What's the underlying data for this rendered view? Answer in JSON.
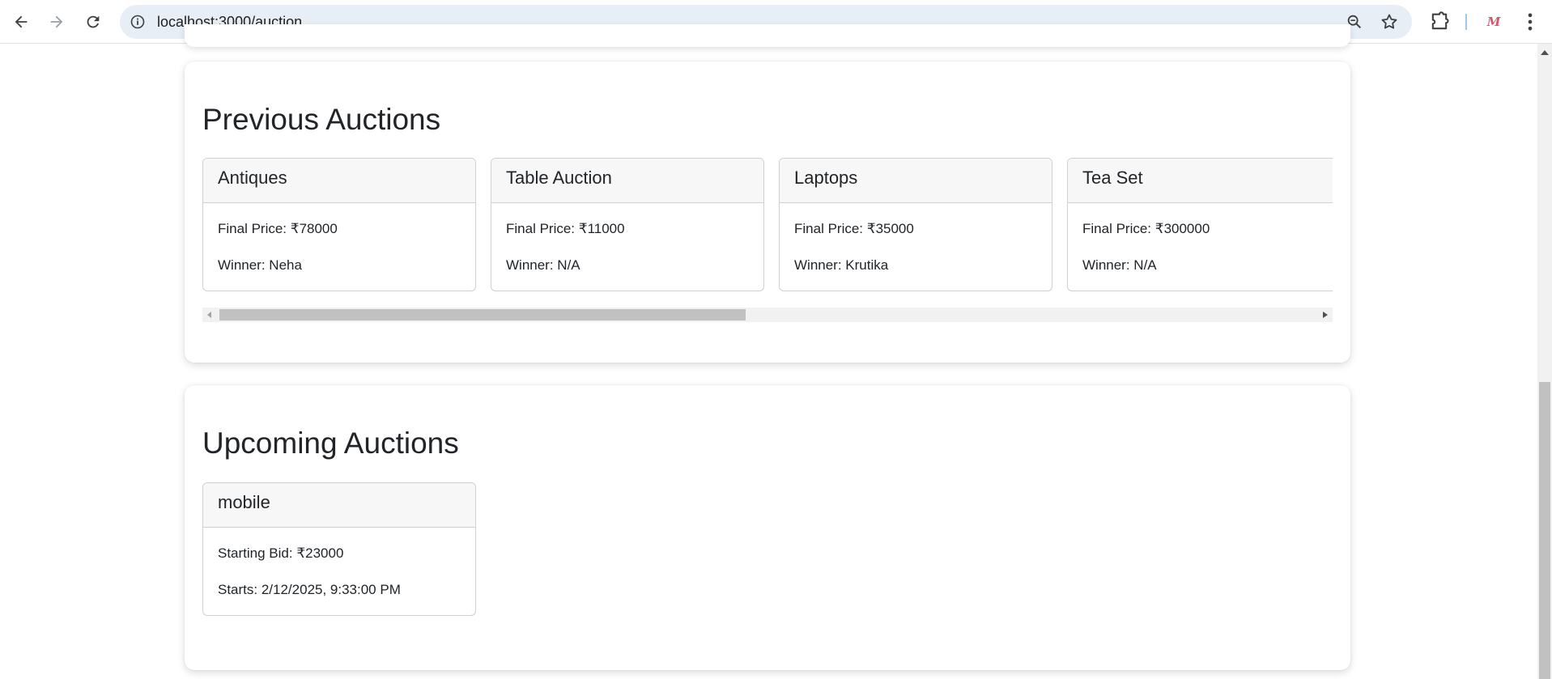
{
  "browser": {
    "url": "localhost:3000/auction",
    "profile_letter": "M"
  },
  "previous": {
    "title": "Previous Auctions",
    "cards": [
      {
        "name": "Antiques",
        "price": "Final Price: ₹78000",
        "winner": "Winner: Neha"
      },
      {
        "name": "Table Auction",
        "price": "Final Price: ₹11000",
        "winner": "Winner: N/A"
      },
      {
        "name": "Laptops",
        "price": "Final Price: ₹35000",
        "winner": "Winner: Krutika"
      },
      {
        "name": "Tea Set",
        "price": "Final Price: ₹300000",
        "winner": "Winner: N/A"
      }
    ],
    "scroll_fraction_visible": 0.48
  },
  "upcoming": {
    "title": "Upcoming Auctions",
    "cards": [
      {
        "name": "mobile",
        "bid": "Starting Bid: ₹23000",
        "starts": "Starts: 2/12/2025, 9:33:00 PM"
      }
    ]
  },
  "colors": {
    "omnibox_bg": "#e8eef5",
    "card_header_bg": "#f7f7f7",
    "text": "#212529"
  }
}
